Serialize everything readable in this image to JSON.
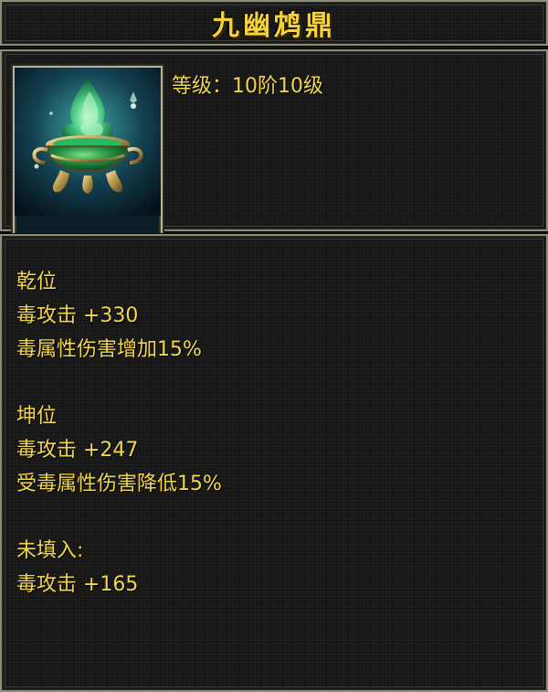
{
  "item": {
    "name": "九幽鸩鼎",
    "icon": "green-poison-cauldron-icon",
    "level_label": "等级：",
    "level_value": "10阶10级"
  },
  "stats": {
    "groups": [
      {
        "title": "乾位",
        "lines": [
          "毒攻击 +330",
          "毒属性伤害增加15%"
        ]
      },
      {
        "title": "坤位",
        "lines": [
          "毒攻击 +247",
          "受毒属性伤害降低15%"
        ]
      },
      {
        "title": "未填入:",
        "lines": [
          "毒攻击 +165"
        ]
      }
    ]
  },
  "colors": {
    "title_gold": "#f4d23a",
    "text_gold": "#f1d64f",
    "frame": "#8c8c7a",
    "background": "#181818"
  }
}
